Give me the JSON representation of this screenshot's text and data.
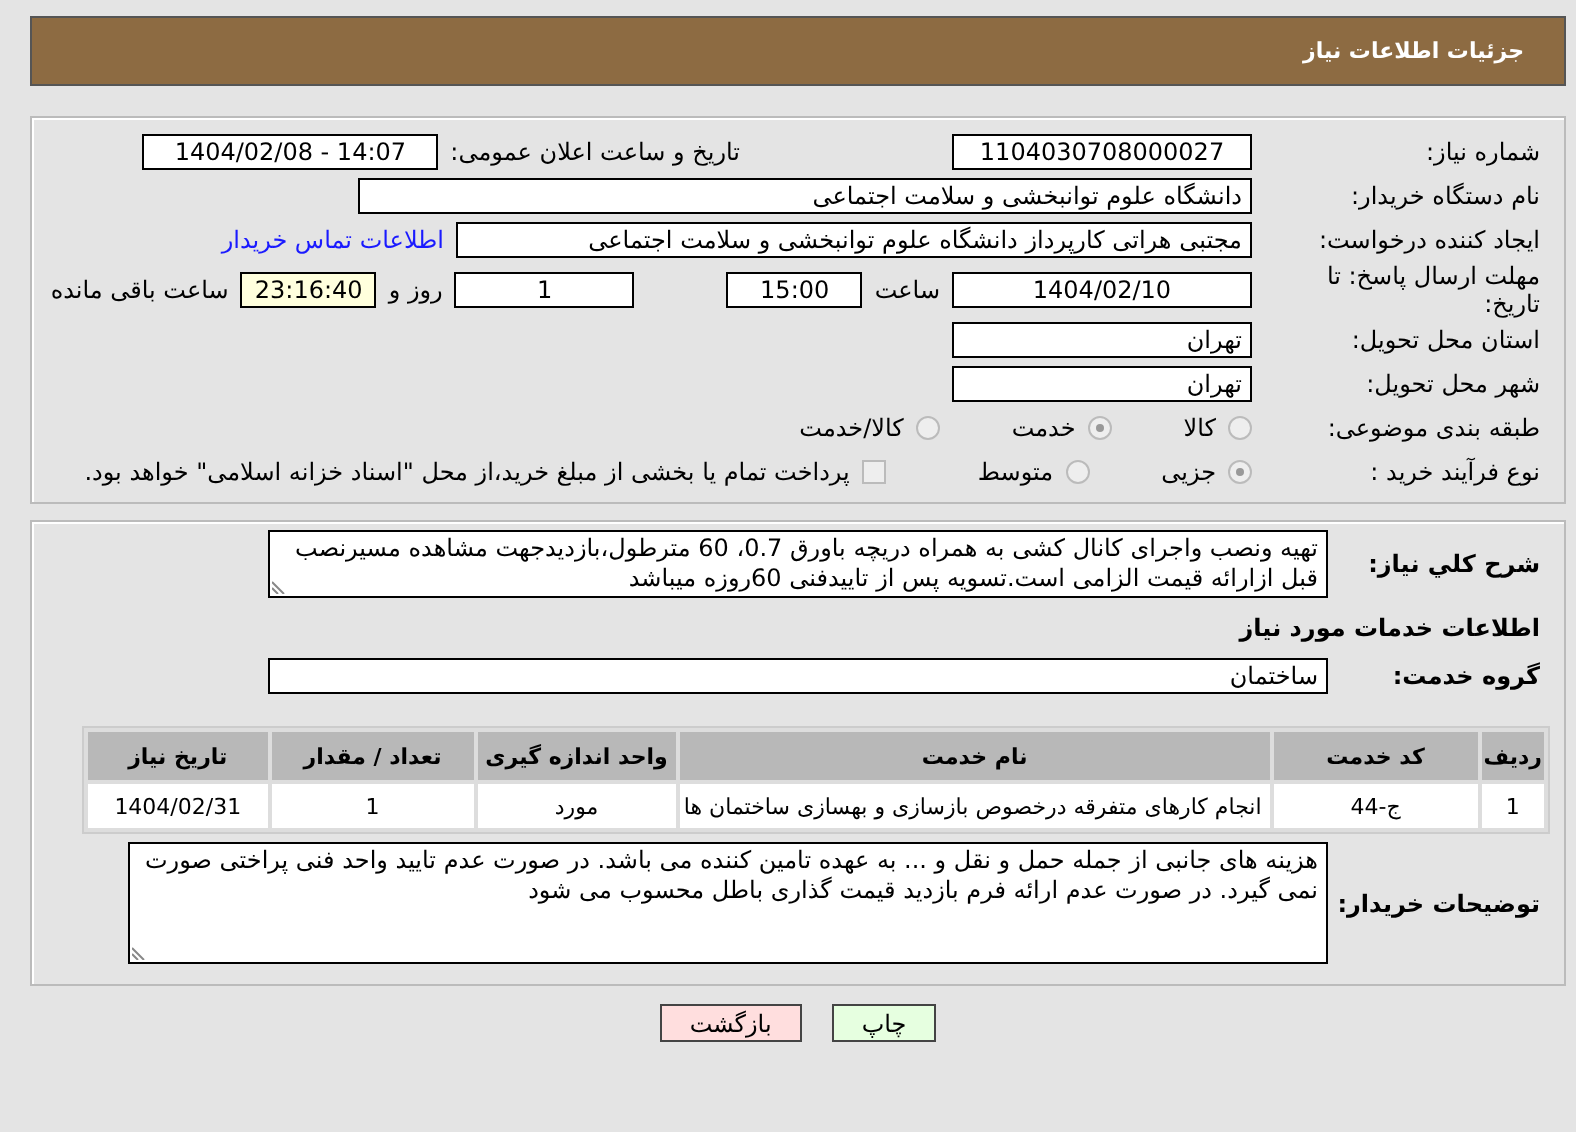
{
  "header": {
    "title": "جزئیات اطلاعات نیاز"
  },
  "need_number": {
    "label": "شماره نیاز:",
    "value": "1104030708000027"
  },
  "announce_datetime": {
    "label": "تاریخ و ساعت اعلان عمومی:",
    "value": "1404/02/08 - 14:07"
  },
  "buyer_org": {
    "label": "نام دستگاه خریدار:",
    "value": "دانشگاه علوم توانبخشی و سلامت اجتماعی"
  },
  "requester": {
    "label": "ایجاد کننده درخواست:",
    "value": "مجتبی هراتی کارپرداز دانشگاه علوم توانبخشی و سلامت اجتماعی",
    "contact_link": "اطلاعات تماس خریدار"
  },
  "deadline": {
    "label": "مهلت ارسال پاسخ: تا تاریخ:",
    "date": "1404/02/10",
    "time_label": "ساعت",
    "time": "15:00",
    "days": "1",
    "days_label": "روز و",
    "remaining": "23:16:40",
    "remaining_label": "ساعت باقی مانده"
  },
  "province": {
    "label": "استان محل تحویل:",
    "value": "تهران"
  },
  "city": {
    "label": "شهر محل تحویل:",
    "value": "تهران"
  },
  "category": {
    "label": "طبقه بندی موضوعی:",
    "options": [
      {
        "label": "کالا",
        "selected": false
      },
      {
        "label": "خدمت",
        "selected": true
      },
      {
        "label": "کالا/خدمت",
        "selected": false
      }
    ]
  },
  "purchase_type": {
    "label": "نوع فرآیند خرید :",
    "options": [
      {
        "label": "جزیی",
        "selected": true
      },
      {
        "label": "متوسط",
        "selected": false
      }
    ],
    "payment_note": {
      "label": "پرداخت تمام یا بخشی از مبلغ خرید،از محل \"اسناد خزانه اسلامی\" خواهد بود.",
      "checked": false
    }
  },
  "description": {
    "label": "شرح کلي نیاز:",
    "value": "تهیه ونصب واجرای کانال کشی به همراه دریچه باورق 0.7، 60 مترطول،بازدیدجهت مشاهده مسیرنصب قبل ازارائه قیمت الزامی است.تسویه پس از تاییدفنی 60روزه میباشد"
  },
  "services_heading": "اطلاعات خدمات مورد نیاز",
  "service_group": {
    "label": "گروه خدمت:",
    "value": "ساختمان"
  },
  "table": {
    "columns": [
      "ردیف",
      "کد خدمت",
      "نام خدمت",
      "واحد اندازه گیری",
      "تعداد / مقدار",
      "تاریخ نیاز"
    ],
    "rows": [
      [
        "1",
        "ج-44",
        "انجام کارهای متفرقه درخصوص بازسازی و بهسازی ساختمان ها",
        "مورد",
        "1",
        "1404/02/31"
      ]
    ]
  },
  "buyer_notes": {
    "label": "توضیحات خریدار:",
    "value": "هزینه های جانبی از جمله حمل و نقل و ... به عهده تامین کننده می باشد. در صورت عدم تایید واحد فنی پراختی صورت نمی گیرد. در صورت عدم ارائه فرم بازدید قیمت گذاری باطل محسوب می شود"
  },
  "buttons": [
    {
      "label": "چاپ",
      "kind": "print"
    },
    {
      "label": "بازگشت",
      "kind": "back"
    }
  ]
}
